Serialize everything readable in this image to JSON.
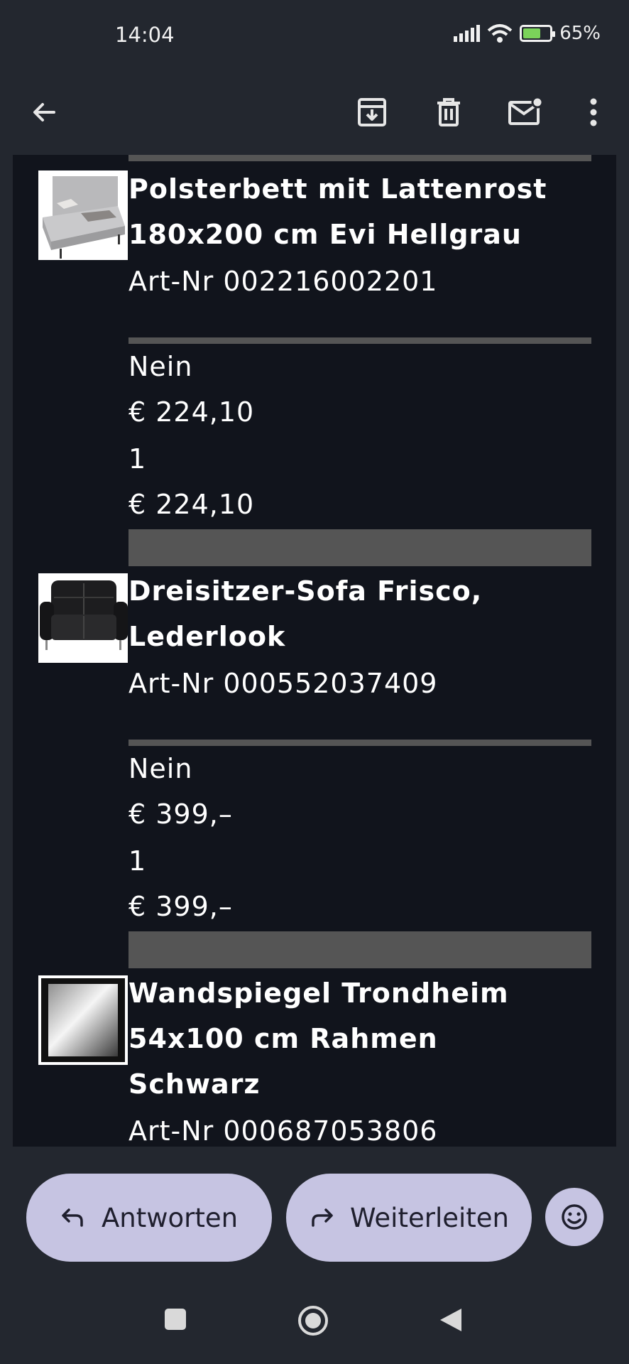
{
  "status": {
    "time": "14:04",
    "battery_percent": "65%"
  },
  "toolbar": {
    "back_icon": "arrow-left-icon",
    "archive_icon": "archive-icon",
    "delete_icon": "trash-icon",
    "mark_unread_icon": "mail-unread-icon",
    "more_icon": "more-vertical-icon"
  },
  "order_items": [
    {
      "title": "Polsterbett mit Lattenrost 180x200 cm Evi Hellgrau",
      "title_lines": [
        "Polsterbett mit Lattenrost",
        "180x200 cm Evi Hellgrau"
      ],
      "art_nr": "Art-Nr 002216002201",
      "option": "Nein",
      "unit_price": "€ 224,10",
      "quantity": "1",
      "total": "€ 224,10"
    },
    {
      "title": "Dreisitzer-Sofa Frisco, Lederlook",
      "title_lines": [
        "Dreisitzer-Sofa Frisco,",
        "Lederlook"
      ],
      "art_nr": "Art-Nr 000552037409",
      "option": "Nein",
      "unit_price": "€ 399,–",
      "quantity": "1",
      "total": "€ 399,–"
    },
    {
      "title": "Wandspiegel Trondheim 54x100 cm Rahmen Schwarz",
      "title_lines": [
        "Wandspiegel Trondheim",
        "54x100 cm Rahmen",
        "Schwarz"
      ],
      "art_nr": "Art-Nr 000687053806"
    }
  ],
  "actions": {
    "reply_label": "Antworten",
    "forward_label": "Weiterleiten",
    "emoji_icon": "smiley-icon"
  },
  "colors": {
    "background": "#23272f",
    "content_bg": "#11141c",
    "divider": "#555555",
    "pill": "#c6c4e2"
  }
}
